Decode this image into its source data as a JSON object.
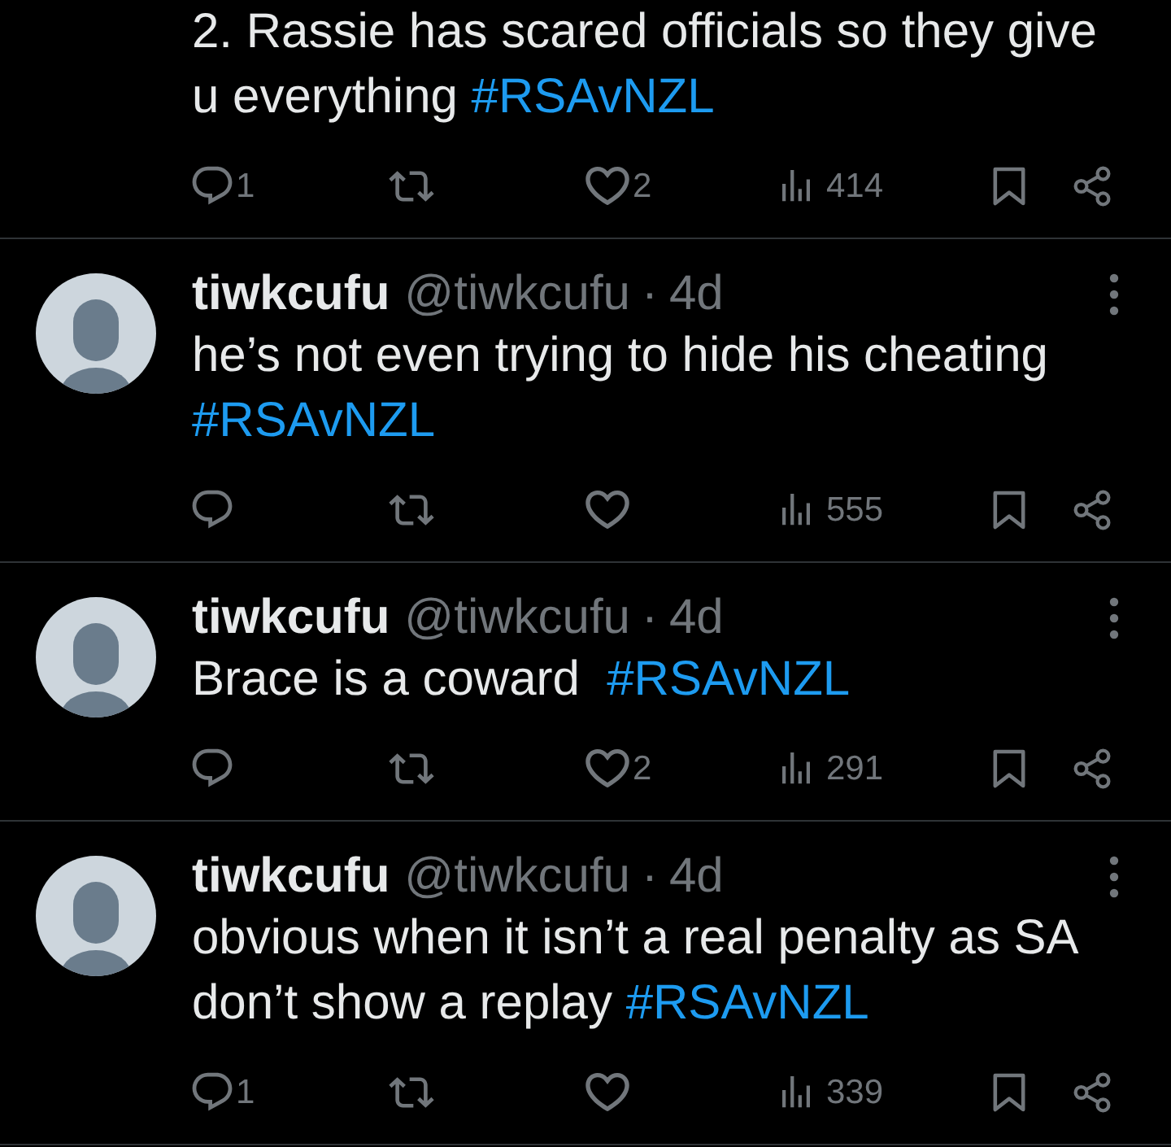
{
  "tweets": [
    {
      "text": [
        {
          "kind": "plain",
          "text": "2. Rassie has scared officials so they give u everything "
        },
        {
          "kind": "hashtag",
          "text": "#RSAvNZL"
        }
      ],
      "actions": [
        {
          "kind": "reply",
          "count": "1"
        },
        {
          "kind": "repost"
        },
        {
          "kind": "like",
          "count": "2"
        },
        {
          "kind": "views",
          "count": "414"
        },
        {
          "kind": "bookmark"
        },
        {
          "kind": "share"
        }
      ]
    },
    {
      "author": {
        "name": "tiwkcufu",
        "handle": "@tiwkcufu",
        "separator": "·",
        "time": "4d"
      },
      "text": [
        {
          "kind": "plain",
          "text": "he’s not even trying to hide his cheating "
        },
        {
          "kind": "hashtag",
          "text": "#RSAvNZL"
        }
      ],
      "actions": [
        {
          "kind": "reply"
        },
        {
          "kind": "repost"
        },
        {
          "kind": "like"
        },
        {
          "kind": "views",
          "count": "555"
        },
        {
          "kind": "bookmark"
        },
        {
          "kind": "share"
        }
      ]
    },
    {
      "author": {
        "name": "tiwkcufu",
        "handle": "@tiwkcufu",
        "separator": "·",
        "time": "4d"
      },
      "text": [
        {
          "kind": "plain",
          "text": "Brace is a coward  "
        },
        {
          "kind": "hashtag",
          "text": "#RSAvNZL"
        }
      ],
      "actions": [
        {
          "kind": "reply"
        },
        {
          "kind": "repost"
        },
        {
          "kind": "like",
          "count": "2"
        },
        {
          "kind": "views",
          "count": "291"
        },
        {
          "kind": "bookmark"
        },
        {
          "kind": "share"
        }
      ]
    },
    {
      "author": {
        "name": "tiwkcufu",
        "handle": "@tiwkcufu",
        "separator": "·",
        "time": "4d"
      },
      "text": [
        {
          "kind": "plain",
          "text": "obvious when it isn’t a real penalty as SA don’t show a replay "
        },
        {
          "kind": "hashtag",
          "text": "#RSAvNZL"
        }
      ],
      "actions": [
        {
          "kind": "reply",
          "count": "1"
        },
        {
          "kind": "repost"
        },
        {
          "kind": "like"
        },
        {
          "kind": "views",
          "count": "339"
        },
        {
          "kind": "bookmark"
        },
        {
          "kind": "share"
        }
      ]
    }
  ]
}
